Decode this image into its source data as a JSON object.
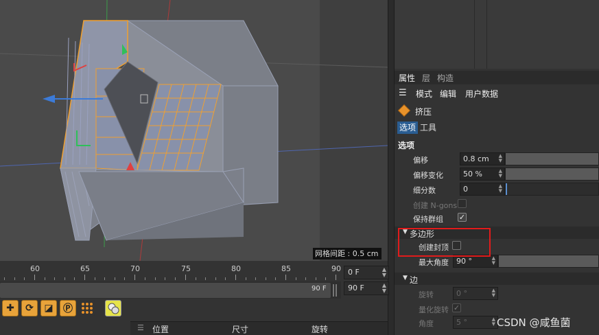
{
  "viewport": {
    "grid_spacing_label": "网格间距 : 0.5 cm"
  },
  "timeline": {
    "ticks": [
      "60",
      "65",
      "70",
      "75",
      "80",
      "85",
      "90"
    ],
    "scroll_end_label": "90 F",
    "start_frame": "0 F",
    "end_frame": "90 F"
  },
  "toolbar": {
    "move_icon": "move-icon",
    "rotate_icon": "rotate-icon",
    "scale_icon": "scale-icon",
    "parameter_icon": "parameter-icon",
    "points_icon": "points-icon",
    "render_icon": "render-icon"
  },
  "coordinates": {
    "position_label": "位置",
    "size_label": "尺寸",
    "rotation_label": "旋转"
  },
  "attributes": {
    "tabs": [
      "属性",
      "层",
      "构造"
    ],
    "menu": [
      "模式",
      "编辑",
      "用户数据"
    ],
    "object_name": "挤压",
    "sub_tabs": [
      "选项",
      "工具"
    ],
    "section_title": "选项",
    "offset": {
      "label": "偏移",
      "value": "0.8 cm"
    },
    "offset_variation": {
      "label": "偏移变化",
      "value": "50 %"
    },
    "subdivision": {
      "label": "细分数",
      "value": "0"
    },
    "create_ngons": {
      "label": "创建 N-gons",
      "checked": false
    },
    "keep_groups": {
      "label": "保持群组",
      "checked": true
    },
    "polygon_group": {
      "title": "多边形",
      "create_caps": {
        "label": "创建封顶",
        "checked": false
      },
      "max_angle": {
        "label": "最大角度",
        "value": "90 °"
      }
    },
    "edge_group": {
      "title": "边",
      "rotate": {
        "label": "旋转",
        "value": "0 °"
      },
      "quantize_rotation": {
        "label": "量化旋转",
        "checked": true
      },
      "angle": {
        "label": "角度",
        "value": "5 °"
      }
    }
  },
  "watermark": "CSDN @咸鱼菌",
  "colors": {
    "accent_blue": "#2a5d92",
    "highlight_red": "#e21b1b",
    "selection_orange": "#f0a030"
  }
}
